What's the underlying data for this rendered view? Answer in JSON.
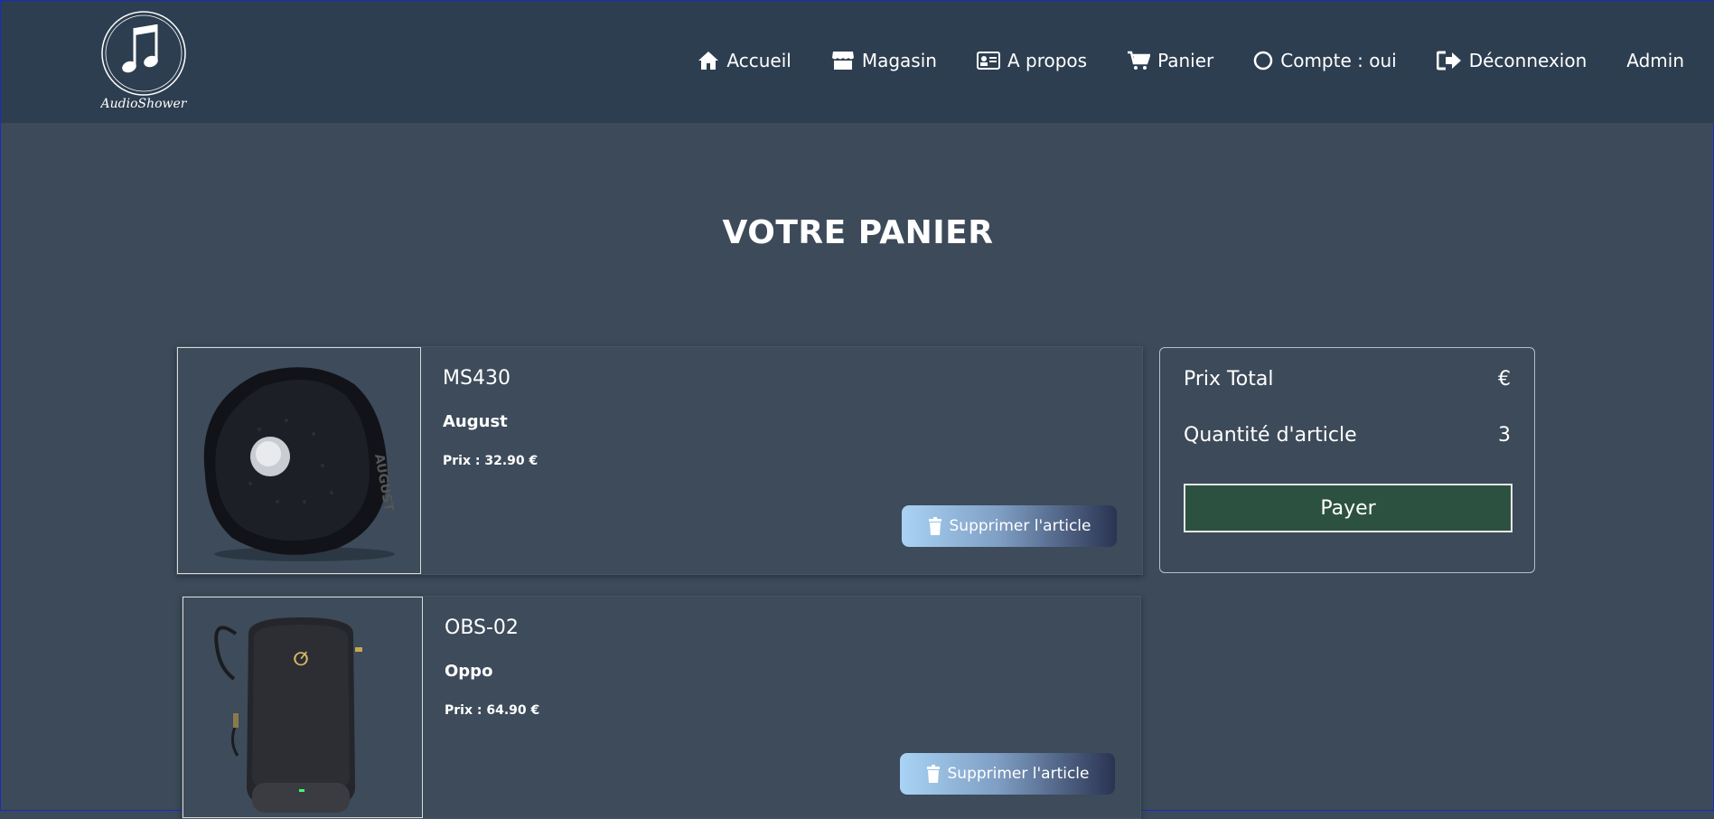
{
  "brand": {
    "name": "AudioShower"
  },
  "nav": {
    "home": "Accueil",
    "shop": "Magasin",
    "about": "A propos",
    "cart": "Panier",
    "account": "Compte : oui",
    "logout": "Déconnexion",
    "admin": "Admin"
  },
  "page": {
    "title": "VOTRE PANIER"
  },
  "cart": {
    "items": [
      {
        "name": "MS430",
        "brand": "August",
        "price": "Prix : 32.90 €",
        "delete_label": "Supprimer l'article"
      },
      {
        "name": "OBS-02",
        "brand": "Oppo",
        "price": "Prix : 64.90 €",
        "delete_label": "Supprimer l'article"
      }
    ]
  },
  "summary": {
    "total_label": "Prix Total",
    "total_value": "€",
    "qty_label": "Quantité d'article",
    "qty_value": "3",
    "pay_label": "Payer"
  },
  "colors": {
    "header_bg": "#2d3e50",
    "page_bg": "#3c4a59",
    "pay_button": "#2d5140"
  }
}
